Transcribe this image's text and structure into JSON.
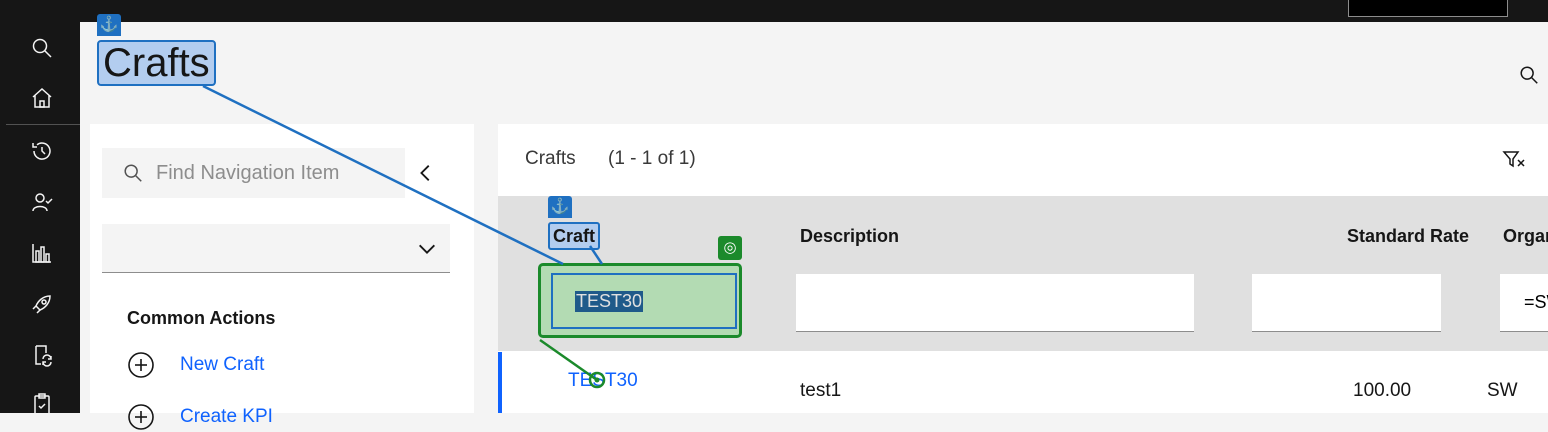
{
  "page": {
    "title": "Crafts"
  },
  "side_panel": {
    "search_placeholder": "Find Navigation Item",
    "dropdown_value": "",
    "common_actions_title": "Common Actions",
    "actions": [
      {
        "label": "New Craft"
      },
      {
        "label": "Create KPI"
      }
    ]
  },
  "table": {
    "title": "Crafts",
    "count": "(1 - 1 of 1)",
    "columns": [
      "Craft",
      "Description",
      "Standard Rate",
      "Organization"
    ],
    "filters": {
      "craft": "TEST30",
      "description": "",
      "standard_rate": "",
      "organization": "=SWRE"
    },
    "rows": [
      {
        "craft": "TEST30",
        "description": "test1",
        "standard_rate": "100.00",
        "organization": "SW"
      }
    ]
  },
  "annotations": {
    "anchor_glyph": "⚓",
    "target_glyph": "◎"
  },
  "colors": {
    "anchor": "#1f70c1",
    "target": "#1b8a2b",
    "link": "#0f62fe",
    "nav_bg": "#161616"
  }
}
